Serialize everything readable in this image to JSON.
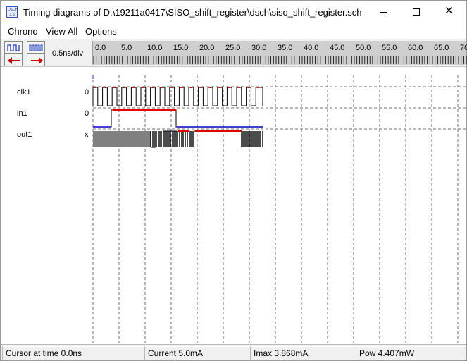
{
  "window": {
    "title": "Timing diagrams of D:\\19211a0417\\SISO_shift_register\\dsch\\siso_shift_register.sch",
    "app_icon_lines": [
      "DSCH",
      "3.5"
    ],
    "controls": {
      "minimize": "minimize-icon",
      "maximize": "maximize-icon",
      "close": "close-icon",
      "close_glyph": "✕"
    }
  },
  "menu": {
    "items": [
      "Chrono",
      "View All",
      "Options"
    ]
  },
  "toolbar": {
    "buttons": [
      {
        "name": "zoom-in-button",
        "icon": "clock-wide-icon"
      },
      {
        "name": "zoom-out-button",
        "icon": "clock-dense-icon"
      },
      {
        "name": "scroll-left-button",
        "icon": "arrow-left-icon"
      },
      {
        "name": "scroll-right-button",
        "icon": "arrow-right-icon"
      }
    ],
    "scale": "0.5ns/div"
  },
  "ruler": {
    "labels": [
      "0.0",
      "5.0",
      "10.0",
      "15.0",
      "20.0",
      "25.0",
      "30.0",
      "35.0",
      "40.0",
      "45.0",
      "50.0",
      "55.0",
      "60.0",
      "65.0",
      "70"
    ]
  },
  "signals": [
    {
      "name": "clk1",
      "value": "0"
    },
    {
      "name": "in1",
      "value": "0"
    },
    {
      "name": "out1",
      "value": "x"
    }
  ],
  "status": {
    "cursor": "Cursor at time  0.0ns",
    "current": "Current  5.0mA",
    "imax": "Imax 3.868mA",
    "pow": "Pow 4.407mW"
  },
  "colors": {
    "trace": "#000000",
    "high_level": "#e00000",
    "low_level": "#0000c0",
    "unknown": "#808080",
    "ruler_bg": "#cfcfcf"
  }
}
